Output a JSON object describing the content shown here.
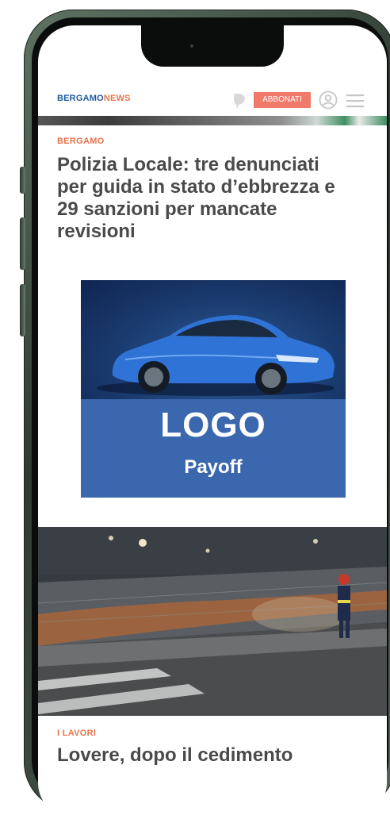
{
  "site": {
    "logo_part1": "BERGAMO",
    "logo_part2": "NEWS",
    "subscribe_label": "ABBONATI",
    "icons": [
      "chat-bubble-icon",
      "user-icon",
      "menu-icon"
    ],
    "brand_blue": "#1f5aa0",
    "accent_orange": "#e8734a",
    "subscribe_color": "#ef7a6a"
  },
  "article1": {
    "category": "BERGAMO",
    "title_lines": [
      "Polizia Locale: tre denunciati",
      "per guida in stato d’ebbrezza e",
      "29 sanzioni per mancate",
      "revisioni"
    ]
  },
  "ad": {
    "logo": "LOGO",
    "payoff": "Payoff",
    "background": "#3a67ad"
  },
  "article2": {
    "category": "I LAVORI",
    "title_line1": "Lovere, dopo il cedimento"
  }
}
